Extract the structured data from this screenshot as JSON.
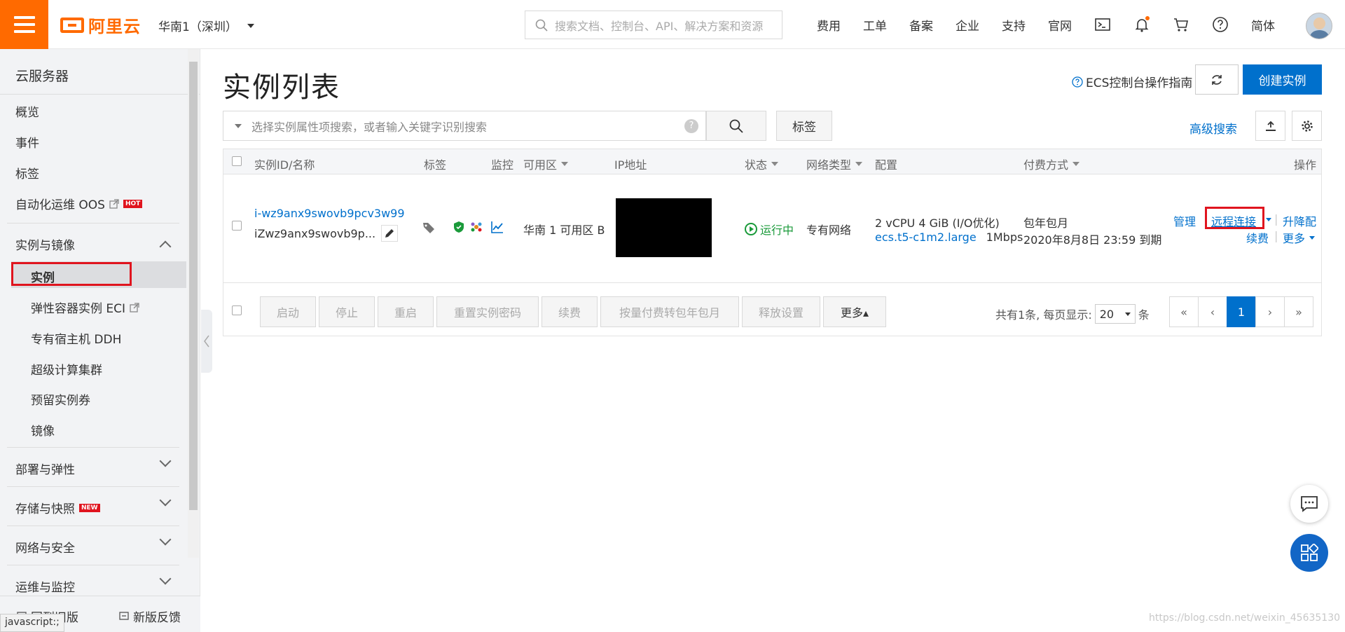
{
  "topbar": {
    "logo_text": "阿里云",
    "region": "华南1（深圳）",
    "search_placeholder": "搜索文档、控制台、API、解决方案和资源",
    "nav": [
      "费用",
      "工单",
      "备案",
      "企业",
      "支持",
      "官网"
    ],
    "lang": "简体",
    "colors": {
      "brand": "#ff6a00",
      "primary": "#0070cc"
    }
  },
  "sidebar": {
    "title": "云服务器",
    "items_top": [
      "概览",
      "事件",
      "标签",
      "自动化运维 OOS"
    ],
    "hot_badge": "HOT",
    "group1": "实例与镜像",
    "group1_items": [
      "实例",
      "弹性容器实例 ECI",
      "专有宿主机 DDH",
      "超级计算集群",
      "预留实例券",
      "镜像"
    ],
    "groups": [
      "部署与弹性",
      "存储与快照",
      "网络与安全",
      "运维与监控"
    ],
    "new_badge": "NEW",
    "footer_left": "回到旧版",
    "footer_right": "新版反馈"
  },
  "status_url": "javascript:;",
  "main": {
    "title": "实例列表",
    "guide": "ECS控制台操作指南",
    "create_button": "创建实例",
    "filter_placeholder": "选择实例属性项搜索，或者输入关键字识别搜索",
    "tag_button": "标签",
    "advanced_search": "高级搜索"
  },
  "table": {
    "headers": [
      "实例ID/名称",
      "标签",
      "监控",
      "可用区",
      "IP地址",
      "状态",
      "网络类型",
      "配置",
      "付费方式",
      "操作"
    ],
    "row": {
      "instance_id": "i-wz9anx9swovb9pcv3w99",
      "instance_name": "iZwz9anx9swovb9p...",
      "zone": "华南 1 可用区 B",
      "status": "运行中",
      "network": "专有网络",
      "config_line1": "2 vCPU 4 GiB (I/O优化)",
      "config_type": "ecs.t5-c1m2.large",
      "bandwidth": "1Mbps",
      "pay_type": "包年包月",
      "expire": "2020年8月8日 23:59 到期",
      "actions": {
        "manage": "管理",
        "remote": "远程连接",
        "upgrade": "升降配",
        "renew": "续费",
        "more": "更多"
      }
    }
  },
  "footer_bar": {
    "buttons": [
      "启动",
      "停止",
      "重启",
      "重置实例密码",
      "续费",
      "按量付费转包年包月",
      "释放设置"
    ],
    "more": "更多▴",
    "total": "共有1条, 每页显示:",
    "page_size": "20",
    "unit": "条",
    "pages": [
      "«",
      "‹",
      "1",
      "›",
      "»"
    ]
  },
  "watermark": "https://blog.csdn.net/weixin_45635130"
}
